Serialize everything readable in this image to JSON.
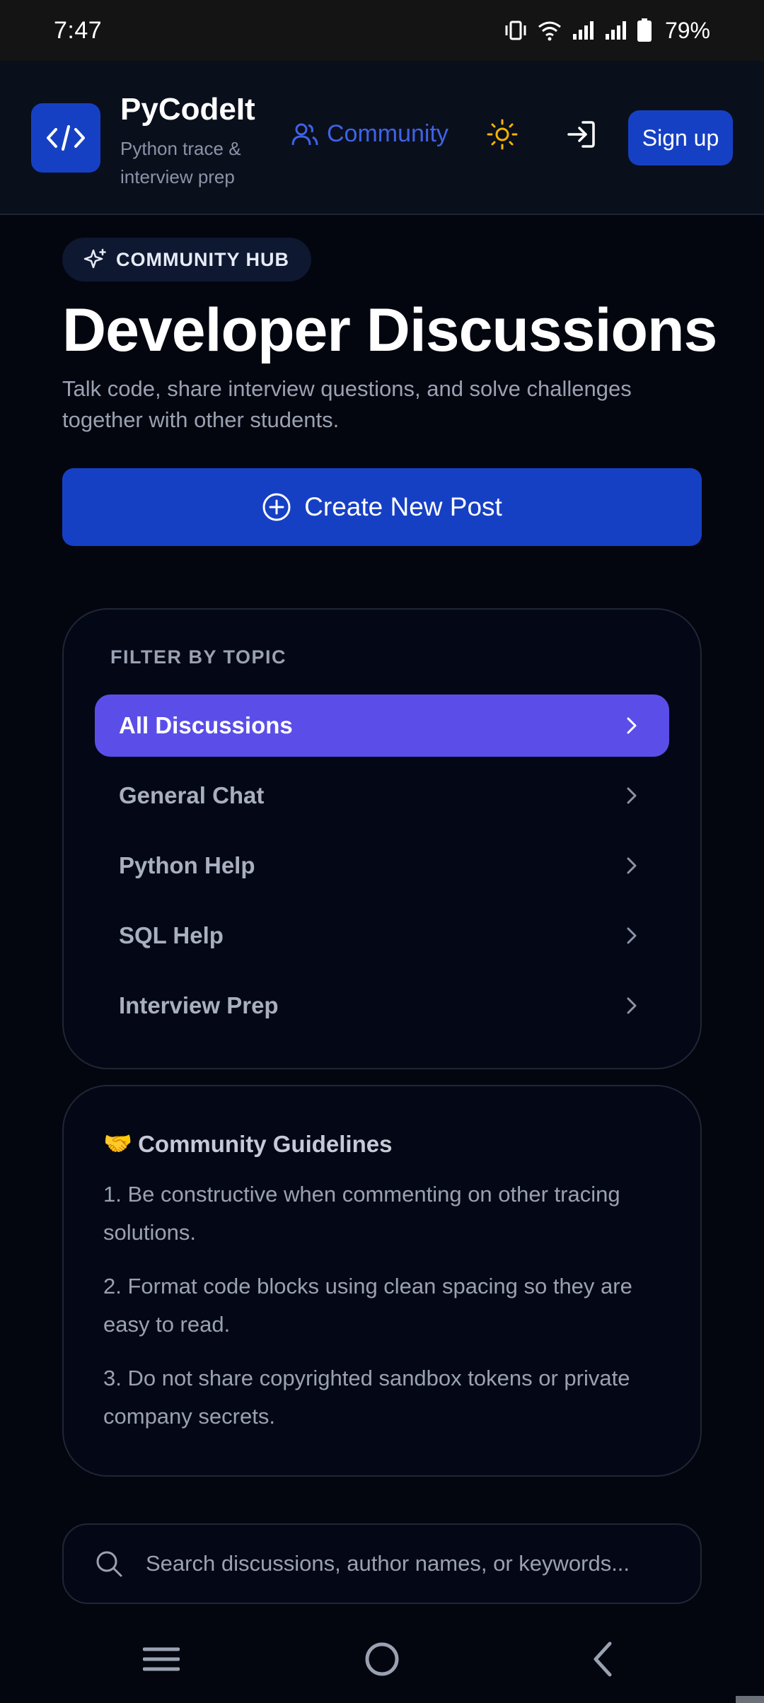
{
  "status_bar": {
    "time": "7:47",
    "battery": "79%",
    "icons": [
      "vibrate-icon",
      "wifi-icon",
      "signal-icon",
      "signal-icon",
      "battery-icon"
    ]
  },
  "header": {
    "logo_icon": "code-icon",
    "brand_name": "PyCodeIt",
    "tagline": "Python trace & interview prep",
    "nav_community": "Community",
    "signup": "Sign up"
  },
  "hero": {
    "badge": "COMMUNITY HUB",
    "title": "Developer Discussions",
    "subtitle": "Talk code, share interview questions, and solve challenges together with other students.",
    "create_post": "Create New Post"
  },
  "filter": {
    "heading": "FILTER BY TOPIC",
    "items": [
      {
        "label": "All Discussions",
        "active": true
      },
      {
        "label": "General Chat",
        "active": false
      },
      {
        "label": "Python Help",
        "active": false
      },
      {
        "label": "SQL Help",
        "active": false
      },
      {
        "label": "Interview Prep",
        "active": false
      }
    ]
  },
  "guidelines": {
    "emoji": "🤝",
    "title": "Community Guidelines",
    "items": [
      "1. Be constructive when commenting on other tracing solutions.",
      "2. Format code blocks using clean spacing so they are easy to read.",
      "3. Do not share copyrighted sandbox tokens or private company secrets."
    ]
  },
  "search": {
    "placeholder": "Search discussions, author names, or keywords..."
  },
  "colors": {
    "accent": "#1640c4",
    "active_topic": "#5b4ee8",
    "background": "#03060f",
    "sun": "#f5b400"
  }
}
